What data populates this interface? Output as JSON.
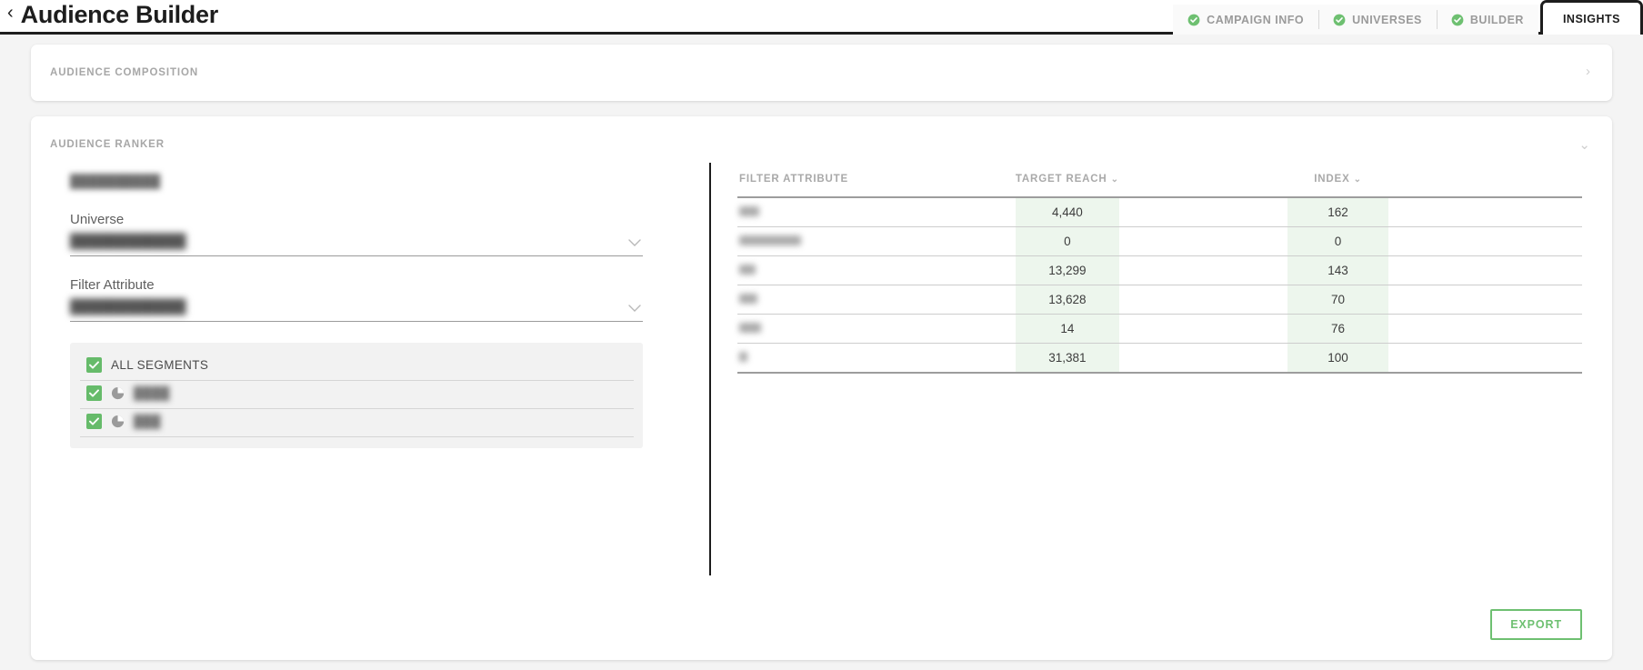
{
  "header": {
    "back_label": "‹",
    "title": "Audience Builder",
    "tabs": [
      {
        "label": "CAMPAIGN INFO",
        "icon": "check-circle-icon",
        "active": false,
        "complete": true
      },
      {
        "label": "UNIVERSES",
        "icon": "check-circle-icon",
        "active": false,
        "complete": true
      },
      {
        "label": "BUILDER",
        "icon": "check-circle-icon",
        "active": false,
        "complete": true
      },
      {
        "label": "INSIGHTS",
        "icon": "",
        "active": true,
        "complete": false
      }
    ]
  },
  "composition_card": {
    "title": "AUDIENCE COMPOSITION",
    "chevron": "›"
  },
  "ranker_card": {
    "title": "AUDIENCE RANKER",
    "chevron": "⌄",
    "audience_name": "██████████",
    "universe": {
      "label": "Universe",
      "value": "████████████",
      "chevron": "⌄"
    },
    "filter_attribute": {
      "label": "Filter Attribute",
      "value": "████████████",
      "chevron": "⌄"
    },
    "segments": {
      "all_label": "ALL SEGMENTS",
      "all_checked": true,
      "items": [
        {
          "label": "████",
          "checked": true,
          "icon": "pie-chart-icon"
        },
        {
          "label": "███",
          "checked": true,
          "icon": "pie-chart-icon"
        }
      ]
    },
    "export_label": "EXPORT"
  },
  "table": {
    "columns": [
      {
        "key": "attribute",
        "label": "FILTER ATTRIBUTE",
        "sortable": false,
        "caret": ""
      },
      {
        "key": "target_reach",
        "label": "TARGET REACH",
        "sortable": true,
        "caret": "⌄"
      },
      {
        "key": "index",
        "label": "INDEX",
        "sortable": true,
        "caret": "⌄"
      }
    ],
    "rows": [
      {
        "attribute": "██",
        "attribute_width": 22,
        "target_reach": "4,440",
        "index": "162"
      },
      {
        "attribute": "███████",
        "attribute_width": 68,
        "target_reach": "0",
        "index": "0"
      },
      {
        "attribute": "██",
        "attribute_width": 18,
        "target_reach": "13,299",
        "index": "143"
      },
      {
        "attribute": "██",
        "attribute_width": 20,
        "target_reach": "13,628",
        "index": "70"
      },
      {
        "attribute": "███",
        "attribute_width": 24,
        "target_reach": "14",
        "index": "76"
      },
      {
        "attribute": "█",
        "attribute_width": 9,
        "target_reach": "31,381",
        "index": "100"
      }
    ]
  },
  "colors": {
    "accent_green": "#66bb6a",
    "export_green": "#6ec071",
    "cell_highlight": "#edf6ed",
    "dark": "#1d1d1d",
    "muted": "#a9a9a9",
    "page_bg": "#f4f4f4"
  }
}
